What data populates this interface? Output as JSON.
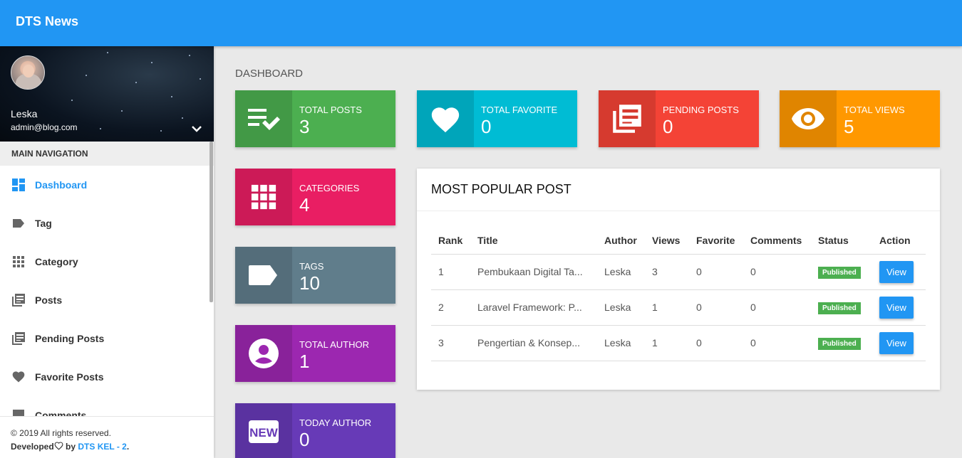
{
  "app": {
    "brand": "DTS News"
  },
  "user": {
    "name": "Leska",
    "email": "admin@blog.com"
  },
  "sidebar": {
    "header": "MAIN NAVIGATION",
    "items": [
      {
        "label": "Dashboard",
        "icon": "dashboard-icon",
        "active": true
      },
      {
        "label": "Tag",
        "icon": "label-icon"
      },
      {
        "label": "Category",
        "icon": "apps-icon"
      },
      {
        "label": "Posts",
        "icon": "library-books-icon"
      },
      {
        "label": "Pending Posts",
        "icon": "library-books-icon"
      },
      {
        "label": "Favorite Posts",
        "icon": "heart-icon"
      },
      {
        "label": "Comments",
        "icon": "comment-icon"
      }
    ]
  },
  "footer": {
    "copyright": "© 2019 All rights reserved.",
    "developed": "Developed",
    "by": "by",
    "team": "DTS KEL - 2",
    "dot": "."
  },
  "page": {
    "title": "DASHBOARD"
  },
  "stats": [
    {
      "label": "TOTAL POSTS",
      "value": "3",
      "color": "#4caf50",
      "icon": "playlist-add-check-icon"
    },
    {
      "label": "TOTAL FAVORITE",
      "value": "0",
      "color": "#00bcd4",
      "icon": "heart-icon"
    },
    {
      "label": "PENDING POSTS",
      "value": "0",
      "color": "#f44336",
      "icon": "library-books-icon"
    },
    {
      "label": "TOTAL VIEWS",
      "value": "5",
      "color": "#ff9800",
      "icon": "eye-icon"
    },
    {
      "label": "CATEGORIES",
      "value": "4",
      "color": "#e91e63",
      "icon": "apps-icon"
    },
    {
      "label": "TAGS",
      "value": "10",
      "color": "#607d8b",
      "icon": "label-icon"
    },
    {
      "label": "TOTAL AUTHOR",
      "value": "1",
      "color": "#9c27b0",
      "icon": "account-circle-icon"
    },
    {
      "label": "TODAY AUTHOR",
      "value": "0",
      "color": "#673ab7",
      "icon": "new-badge-icon"
    }
  ],
  "popular": {
    "title": "MOST POPULAR POST",
    "columns": [
      "Rank",
      "Title",
      "Author",
      "Views",
      "Favorite",
      "Comments",
      "Status",
      "Action"
    ],
    "rows": [
      {
        "rank": "1",
        "title": "Pembukaan Digital Ta...",
        "author": "Leska",
        "views": "3",
        "favorite": "0",
        "comments": "0",
        "status": "Published",
        "action": "View"
      },
      {
        "rank": "2",
        "title": "Laravel Framework: P...",
        "author": "Leska",
        "views": "1",
        "favorite": "0",
        "comments": "0",
        "status": "Published",
        "action": "View"
      },
      {
        "rank": "3",
        "title": "Pengertian & Konsep...",
        "author": "Leska",
        "views": "1",
        "favorite": "0",
        "comments": "0",
        "status": "Published",
        "action": "View"
      }
    ]
  }
}
